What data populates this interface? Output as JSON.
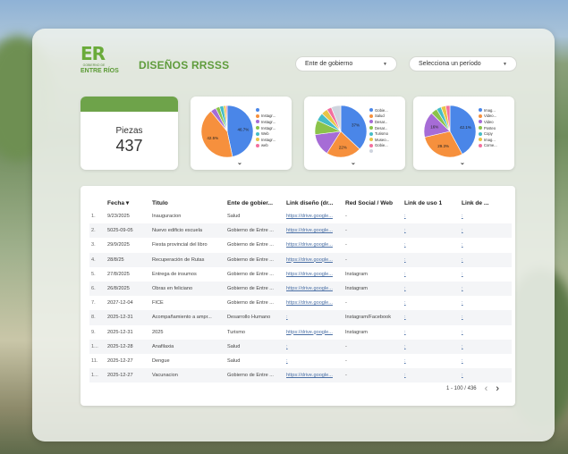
{
  "header": {
    "logo_text": "ER",
    "logo_sub": "GOBIERNO DE",
    "logo_name": "ENTRE RÍOS",
    "title": "DISEÑOS RRSSS"
  },
  "filters": {
    "entity_label": "Ente de gobierno",
    "period_label": "Selecciona un período"
  },
  "kpi": {
    "label": "Piezas",
    "value": "437",
    "accent": "#6ea34a"
  },
  "pies": [
    {
      "slices": [
        {
          "label": "",
          "value": 46.7,
          "color": "#4a86e8"
        },
        {
          "label": "Instagr...",
          "value": 42.5,
          "color": "#f6903d"
        },
        {
          "label": "Instagr...",
          "value": 3.5,
          "color": "#a66cd6"
        },
        {
          "label": "Instagr...",
          "value": 2.5,
          "color": "#8bc34a"
        },
        {
          "label": "Web",
          "value": 2.5,
          "color": "#46bdc6"
        },
        {
          "label": "Instagr...",
          "value": 1.5,
          "color": "#e8c547"
        },
        {
          "label": "web",
          "value": 0.8,
          "color": "#f36f9e"
        }
      ],
      "labels": [
        "46.7%",
        "42.5%"
      ]
    },
    {
      "slices": [
        {
          "label": "Gobie...",
          "value": 37,
          "color": "#4a86e8"
        },
        {
          "label": "Salud",
          "value": 22,
          "color": "#f6903d"
        },
        {
          "label": "Desar...",
          "value": 14,
          "color": "#a66cd6"
        },
        {
          "label": "Desar...",
          "value": 9,
          "color": "#8bc34a"
        },
        {
          "label": "Turismo",
          "value": 5,
          "color": "#46bdc6"
        },
        {
          "label": "Museo...",
          "value": 4,
          "color": "#e8c547"
        },
        {
          "label": "Gobie...",
          "value": 3,
          "color": "#f36f9e"
        },
        {
          "label": "",
          "value": 6,
          "color": "#cfd4de"
        }
      ],
      "labels": [
        "37%",
        "22%"
      ]
    },
    {
      "slices": [
        {
          "label": "Imag...",
          "value": 42.1,
          "color": "#4a86e8"
        },
        {
          "label": "Video...",
          "value": 29.3,
          "color": "#f6903d"
        },
        {
          "label": "Video",
          "value": 16,
          "color": "#a66cd6"
        },
        {
          "label": "Posteo",
          "value": 4,
          "color": "#8bc34a"
        },
        {
          "label": "Copy",
          "value": 3,
          "color": "#46bdc6"
        },
        {
          "label": "Imag...",
          "value": 3,
          "color": "#e8c547"
        },
        {
          "label": "Come...",
          "value": 2.6,
          "color": "#f36f9e"
        }
      ],
      "labels": [
        "42.1%",
        "29.3%",
        "16%"
      ]
    }
  ],
  "table": {
    "headers": [
      "",
      "Fecha ▾",
      "Titulo",
      "Ente de gobier...",
      "Link diseño (dr...",
      "Red Social / Web",
      "Link de uso 1",
      "Link de ..."
    ],
    "rows": [
      [
        "1.",
        "9/23/2025",
        "Inauguracion",
        "Salud",
        "https://drive.google...",
        "-",
        ":",
        ":"
      ],
      [
        "2.",
        "5025-09-05",
        "Nuevo edificio escuela",
        "Gobierno de Entre ...",
        "https://drive.google...",
        "-",
        ":",
        ":"
      ],
      [
        "3.",
        "29/9/2025",
        "Fiesta provincial del libro",
        "Gobierno de Entre ...",
        "https://drive.google...",
        "-",
        ":",
        ":"
      ],
      [
        "4.",
        "28/8/25",
        "Recuperación de Rutas",
        "Gobierno de Entre ...",
        "https://drive.google...",
        "-",
        ":",
        ":"
      ],
      [
        "5.",
        "27/8/2025",
        "Entrega de insumos",
        "Gobierno de Entre ...",
        "https://drive.google...",
        "Instagram",
        ":",
        ":"
      ],
      [
        "6.",
        "26/8/2025",
        "Obras en feliciano",
        "Gobierno de Entre ...",
        "https://drive.google...",
        "Instagram",
        ":",
        ":"
      ],
      [
        "7.",
        "2027-12-04",
        "FICE",
        "Gobierno de Entre ...",
        "https://drive.google...",
        "-",
        ":",
        ":"
      ],
      [
        "8.",
        "2025-12-31",
        "Acompañamiento a ampr...",
        "Desarrollo Humano",
        ":",
        "Instagram/Facebook",
        ":",
        ":"
      ],
      [
        "9.",
        "2025-12-31",
        "2025",
        "Turismo",
        "https://drive.google...",
        "Instagram",
        ":",
        ":"
      ],
      [
        "1...",
        "2025-12-28",
        "Anafilaxia",
        "Salud",
        ":",
        "-",
        ":",
        ":"
      ],
      [
        "11.",
        "2025-12-27",
        "Dengue",
        "Salud",
        ":",
        "-",
        ":",
        ":"
      ],
      [
        "1...",
        "2025-12-27",
        "Vacunacion",
        "Gobierno de Entre ...",
        "https://drive.google...",
        "-",
        ":",
        ":"
      ]
    ],
    "pagination": "1 - 100 / 436",
    "prev": "‹",
    "next": "›"
  }
}
